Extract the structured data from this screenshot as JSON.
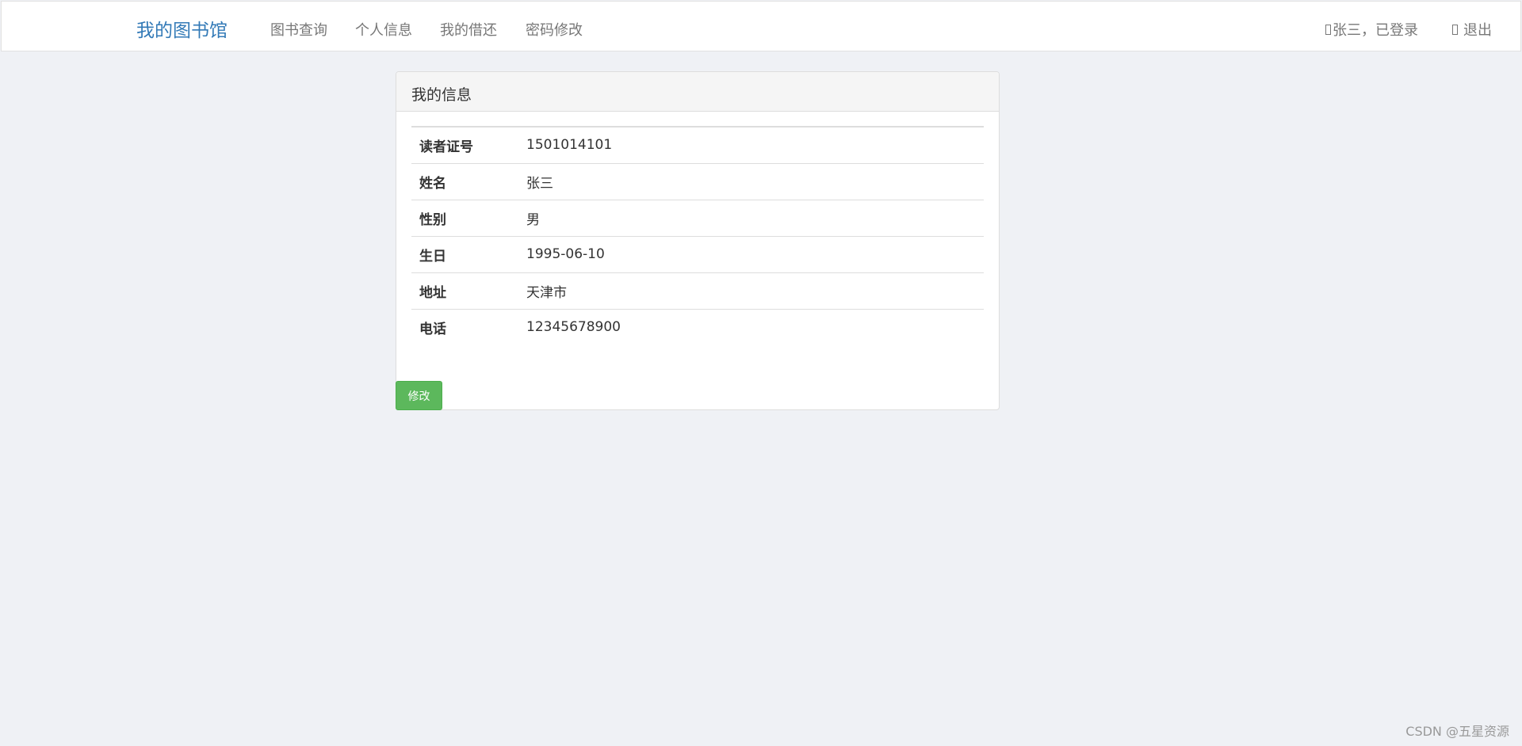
{
  "navbar": {
    "brand": "我的图书馆",
    "links": [
      "图书查询",
      "个人信息",
      "我的借还",
      "密码修改"
    ],
    "user_status": "张三，已登录",
    "logout": "退出"
  },
  "panel": {
    "title": "我的信息",
    "rows": [
      {
        "label": "读者证号",
        "value": "1501014101"
      },
      {
        "label": "姓名",
        "value": "张三"
      },
      {
        "label": "性别",
        "value": "男"
      },
      {
        "label": "生日",
        "value": "1995-06-10"
      },
      {
        "label": "地址",
        "value": "天津市"
      },
      {
        "label": "电话",
        "value": "12345678900"
      }
    ],
    "edit_label": "修改"
  },
  "watermark": "CSDN @五星资源",
  "colors": {
    "brand": "#337ab7",
    "background": "#eff1f5",
    "success_button": "#5cb85c"
  },
  "icons": {
    "user": "user-icon",
    "logout": "logout-icon"
  }
}
